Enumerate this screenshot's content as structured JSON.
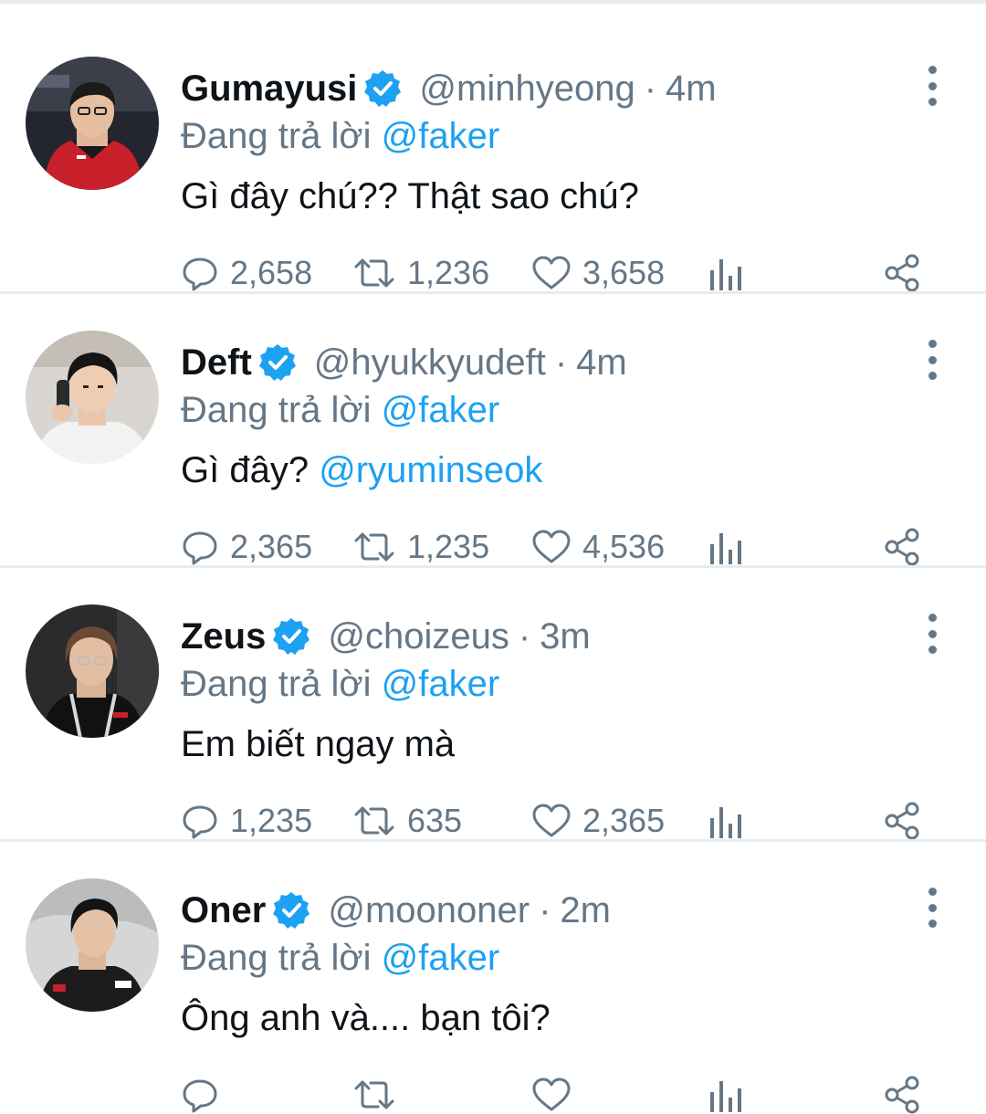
{
  "labels": {
    "replying_to": "Đang trả lời"
  },
  "colors": {
    "verified": "#1da1f2",
    "mention": "#1da1f2",
    "secondary_text": "#657786"
  },
  "tweets": [
    {
      "name": "Gumayusi",
      "handle": "@minhyeong",
      "time": "4m",
      "reply_to": "@faker",
      "text": "Gì đây chú?? Thật sao chú?",
      "mention": "",
      "replies": "2,658",
      "retweets": "1,236",
      "likes": "3,658",
      "avatar": "avatar-gumayusi"
    },
    {
      "name": "Deft",
      "handle": "@hyukkyudeft",
      "time": "4m",
      "reply_to": "@faker",
      "text": "Gì đây? ",
      "mention": "@ryuminseok",
      "replies": "2,365",
      "retweets": "1,235",
      "likes": "4,536",
      "avatar": "avatar-deft"
    },
    {
      "name": "Zeus",
      "handle": "@choizeus",
      "time": "3m",
      "reply_to": "@faker",
      "text": "Em biết ngay mà",
      "mention": "",
      "replies": "1,235",
      "retweets": "635",
      "likes": "2,365",
      "avatar": "avatar-zeus"
    },
    {
      "name": "Oner",
      "handle": "@moononer",
      "time": "2m",
      "reply_to": "@faker",
      "text": "Ông anh và.... bạn tôi?",
      "mention": "",
      "replies": "",
      "retweets": "",
      "likes": "",
      "avatar": "avatar-oner"
    }
  ]
}
